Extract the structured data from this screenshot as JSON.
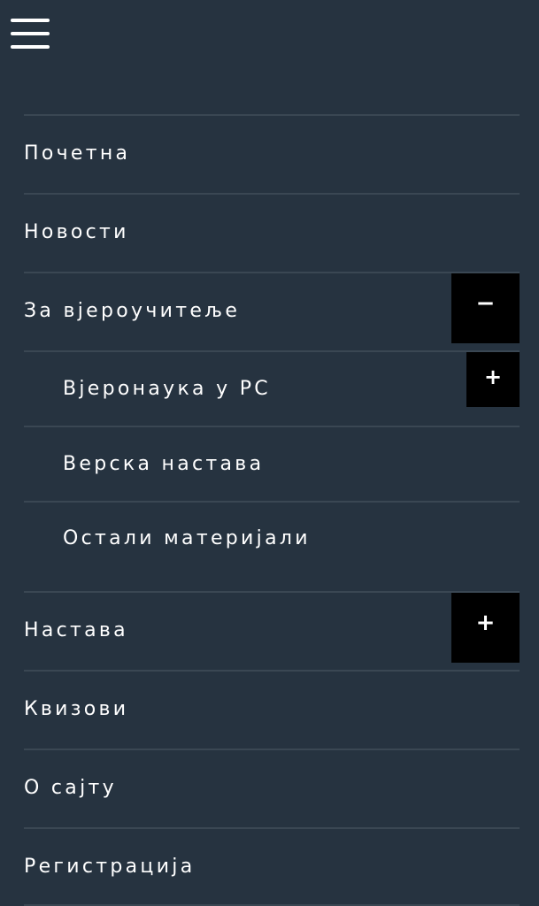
{
  "header": {
    "menu_icon": "hamburger-menu-icon"
  },
  "menu": {
    "items": [
      {
        "label": "Почетна"
      },
      {
        "label": "Новости"
      },
      {
        "label": "За вјероучитеље",
        "toggle": "−"
      },
      {
        "label": "Вјеронаука у РС",
        "toggle": "+"
      },
      {
        "label": "Верска настава"
      },
      {
        "label": "Остали материјали"
      },
      {
        "label": "Настава",
        "toggle": "+"
      },
      {
        "label": "Квизови"
      },
      {
        "label": "О сајту"
      },
      {
        "label": "Регистрација"
      }
    ]
  },
  "colors": {
    "background": "#263340",
    "divider": "#3a4753",
    "toggle_bg": "#000000",
    "text": "#ffffff"
  }
}
